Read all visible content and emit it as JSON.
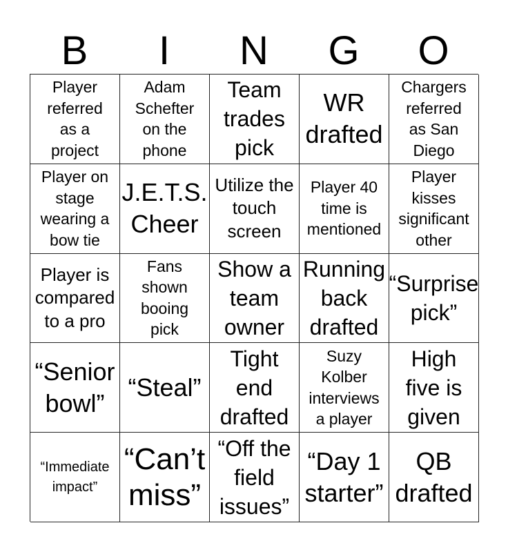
{
  "header": {
    "letters": [
      "B",
      "I",
      "N",
      "G",
      "O"
    ]
  },
  "card": {
    "rows": [
      [
        {
          "text": "Player\nreferred\nas a\nproject",
          "size": "s-sm"
        },
        {
          "text": "Adam\nSchefter\non the\nphone",
          "size": "s-sm"
        },
        {
          "text": "Team\ntrades\npick",
          "size": "s-lg"
        },
        {
          "text": "WR\ndrafted",
          "size": "s-xl"
        },
        {
          "text": "Chargers\nreferred\nas San\nDiego",
          "size": "s-sm"
        }
      ],
      [
        {
          "text": "Player on\nstage\nwearing a\nbow tie",
          "size": "s-sm"
        },
        {
          "text": "J.E.T.S.\nCheer",
          "size": "s-xl"
        },
        {
          "text": "Utilize the\ntouch\nscreen",
          "size": "s-md"
        },
        {
          "text": "Player 40\ntime is\nmentioned",
          "size": "s-sm"
        },
        {
          "text": "Player\nkisses\nsignificant\nother",
          "size": "s-sm"
        }
      ],
      [
        {
          "text": "Player is\ncompared\nto a pro",
          "size": "s-md"
        },
        {
          "text": "Fans\nshown\nbooing\npick",
          "size": "s-sm"
        },
        {
          "text": "Show a\nteam\nowner",
          "size": "s-lg"
        },
        {
          "text": "Running\nback\ndrafted",
          "size": "s-lg"
        },
        {
          "text": "“Surprise\npick”",
          "size": "s-lg"
        }
      ],
      [
        {
          "text": "“Senior\nbowl”",
          "size": "s-xl"
        },
        {
          "text": "“Steal”",
          "size": "s-xl"
        },
        {
          "text": "Tight\nend\ndrafted",
          "size": "s-lg"
        },
        {
          "text": "Suzy\nKolber\ninterviews\na player",
          "size": "s-sm"
        },
        {
          "text": "High\nfive is\ngiven",
          "size": "s-lg"
        }
      ],
      [
        {
          "text": "“Immediate\nimpact”",
          "size": "s-tiny"
        },
        {
          "text": "“Can’t\nmiss”",
          "size": "s-xxl"
        },
        {
          "text": "“Off the\nfield\nissues”",
          "size": "s-lg"
        },
        {
          "text": "“Day 1\nstarter”",
          "size": "s-xl"
        },
        {
          "text": "QB\ndrafted",
          "size": "s-xl"
        }
      ]
    ]
  }
}
